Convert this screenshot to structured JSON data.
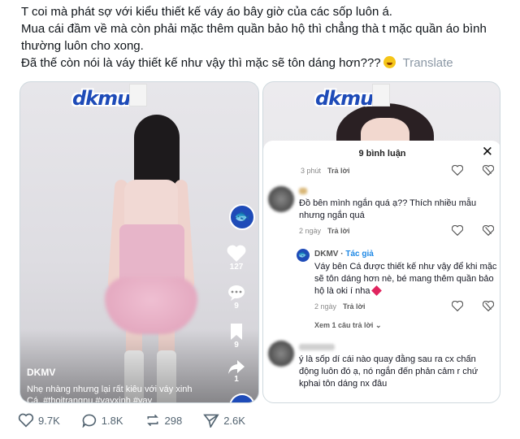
{
  "post": {
    "line1": "T coi mà phát sợ với kiểu thiết kế váy áo bây giờ của các sốp luôn á.",
    "line2": "Mua cái đầm về mà còn phải mặc thêm quần bảo hộ thì chẳng thà t mặc quần áo bình",
    "line3": "thường luôn cho xong.",
    "line4": "Đã thế còn nói là váy thiết kế như vậy thì mặc sẽ tôn dáng hơn???",
    "translate": "Translate"
  },
  "left_video": {
    "logo": "dkmu",
    "author": "DKMV",
    "caption_line1": "Nhẹ nhàng nhưng lại rất kiêu với váy xinh",
    "caption_line2": "Cá. #thoitrangnu #vayxinh #vay",
    "likes": "127",
    "comments": "9",
    "saves": "9",
    "shares": "1"
  },
  "right_video": {
    "logo": "dkmu",
    "sheet_title": "9 bình luận",
    "close": "✕",
    "top_meta_time": "3 phút",
    "top_meta_reply": "Trả lời",
    "comment1_line1": "Đồ bên mình ngắn quá ạ?? Thích nhiều mẫu",
    "comment1_line2": "nhưng ngắn quá",
    "comment1_time": "2 ngày",
    "comment1_reply": "Trả lời",
    "reply_author": "DKMV",
    "reply_tag": "Tác giả",
    "reply_line1": "Váy bên Cá được thiết kế như vậy để khi mặc",
    "reply_line2": "sẽ tôn dáng hơn nè, bé mang thêm quần bảo",
    "reply_line3": "hộ là oki í nha",
    "reply_time": "2 ngày",
    "reply_reply": "Trả lời",
    "view_more": "Xem 1 câu trả lời",
    "comment2_line1": "ý là sốp dí cái nào quay đằng sau ra cx chấn",
    "comment2_line2": "động luôn đó ạ, nó ngắn đến phản cảm r chứ",
    "comment2_line3": "kphai tôn dáng nx đâu"
  },
  "engagement": {
    "likes": "9.7K",
    "replies": "1.8K",
    "reposts": "298",
    "shares": "2.6K"
  },
  "colors": {
    "brand": "#1e4bb8",
    "muted": "#536471",
    "heart": "#e0245e"
  }
}
